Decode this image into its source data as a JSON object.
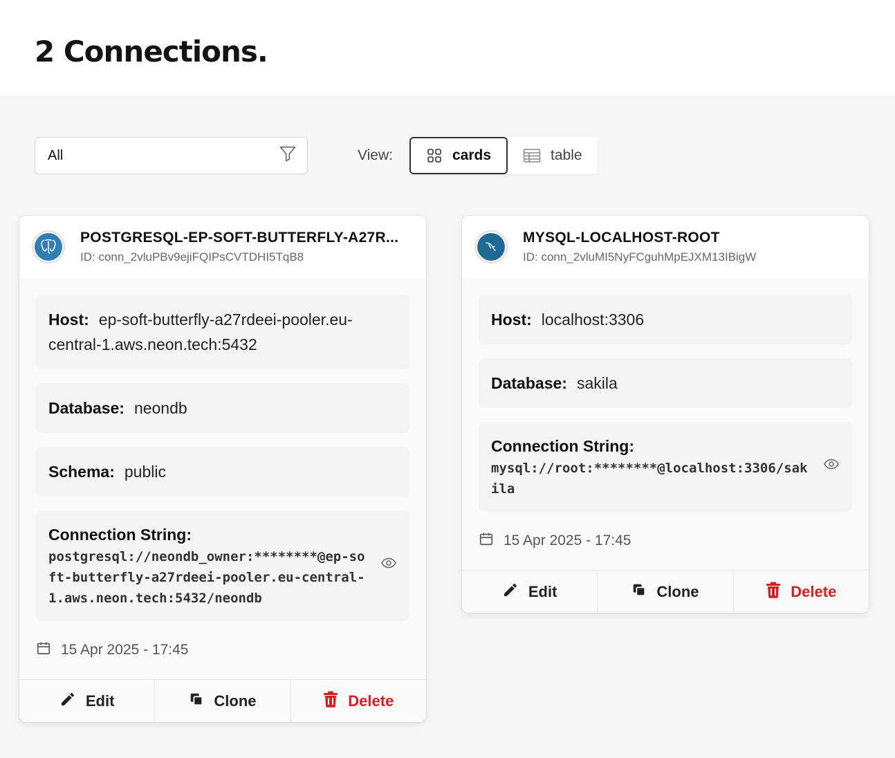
{
  "page": {
    "title": "2 Connections."
  },
  "toolbar": {
    "filter_value": "All",
    "view_label": "View:",
    "view_cards": "cards",
    "view_table": "table"
  },
  "connections": [
    {
      "name": "POSTGRESQL-EP-SOFT-BUTTERFLY-A27R...",
      "id": "ID: conn_2vluPBv9ejiFQIPsCVTDHI5TqB8",
      "logo": "postgresql-logo-icon",
      "host_label": "Host:",
      "host": "ep-soft-butterfly-a27rdeei-pooler.eu-central-1.aws.neon.tech:5432",
      "database_label": "Database:",
      "database": "neondb",
      "schema_label": "Schema:",
      "schema": "public",
      "conn_label": "Connection String:",
      "conn_string": "postgresql://neondb_owner:********@ep-soft-butterfly-a27rdeei-pooler.eu-central-1.aws.neon.tech:5432/neondb",
      "date": "15 Apr 2025 - 17:45"
    },
    {
      "name": "MYSQL-LOCALHOST-ROOT",
      "id": "ID: conn_2vluMI5NyFCguhMpEJXM13IBigW",
      "logo": "mysql-logo-icon",
      "host_label": "Host:",
      "host": "localhost:3306",
      "database_label": "Database:",
      "database": "sakila",
      "conn_label": "Connection String:",
      "conn_string": "mysql://root:********@localhost:3306/sakila",
      "date": "15 Apr 2025 - 17:45"
    }
  ],
  "actions": {
    "edit": "Edit",
    "clone": "Clone",
    "delete": "Delete"
  },
  "colors": {
    "danger": "#d71f1f",
    "postgres": "#2f7fb5",
    "mysql": "#1f6a94"
  }
}
